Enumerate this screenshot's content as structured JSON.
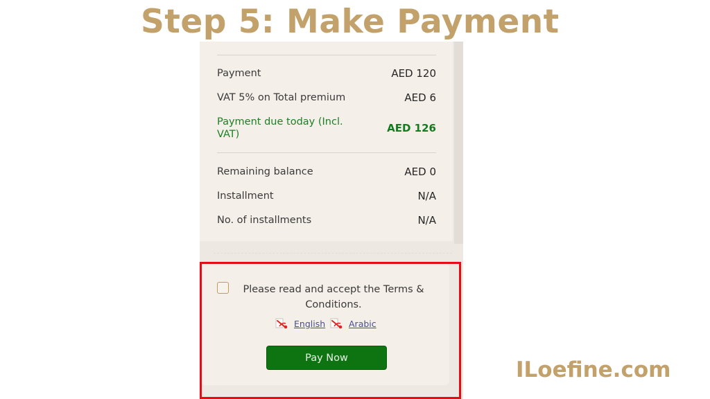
{
  "header": {
    "title": "Step 5: Make Payment"
  },
  "brand": {
    "text": "ILoefine.com"
  },
  "summary": {
    "rows": [
      {
        "label": "Payment",
        "value": "AED 120"
      },
      {
        "label": "VAT 5% on Total premium",
        "value": "AED 6"
      },
      {
        "label": "Payment due today (Incl. VAT)",
        "value": "AED 126"
      },
      {
        "label": "Remaining balance",
        "value": "AED 0"
      },
      {
        "label": "Installment",
        "value": "N/A"
      },
      {
        "label": "No. of installments",
        "value": "N/A"
      }
    ]
  },
  "terms": {
    "text": "Please read and accept the Terms & Conditions.",
    "links": [
      {
        "label": "English",
        "icon": "pdf-icon"
      },
      {
        "label": "Arabic",
        "icon": "pdf-icon"
      }
    ],
    "pay_label": "Pay Now"
  },
  "colors": {
    "title_gold": "#c2a16a",
    "accent_green": "#0e7411",
    "highlight_red": "#e30d18",
    "panel_bg": "#f4efe8"
  }
}
